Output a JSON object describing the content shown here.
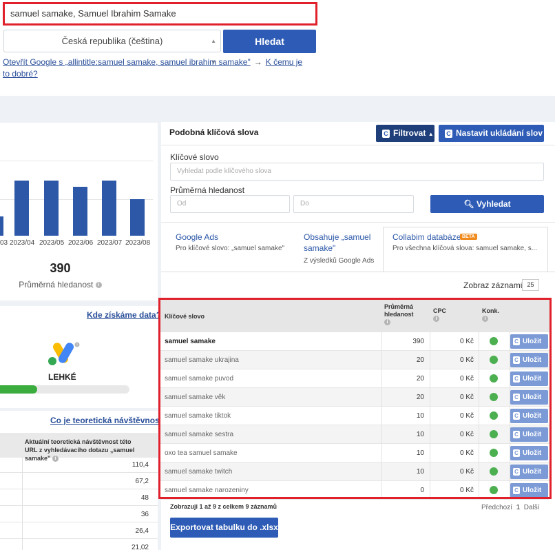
{
  "search": {
    "query": "samuel samake, Samuel Ibrahim Samake",
    "country": "Česká republika (čeština)",
    "submit_label": "Hledat",
    "google_link": "Otevřít Google s „allintitle:samuel samake, samuel ibrahim samake\"",
    "why_link": "K čemu je to dobré?"
  },
  "trend": {
    "x_labels": [
      "03",
      "2023/04",
      "2023/05",
      "2023/06",
      "2023/07",
      "2023/08"
    ],
    "average_value": "390",
    "average_label": "Průměrná hledanost",
    "chart_data": {
      "type": "bar",
      "categories": [
        "03",
        "2023/04",
        "2023/05",
        "2023/06",
        "2023/07",
        "2023/08"
      ],
      "values": [
        200,
        570,
        570,
        510,
        570,
        380
      ],
      "ylim": [
        0,
        800
      ],
      "grid": true
    }
  },
  "difficulty": {
    "link": "Kde získáme data?",
    "value": "LEHKÉ",
    "level": 0.29
  },
  "traffic": {
    "link": "Co je teoretická návštěvnost?",
    "header": "Aktuální teoretická návštěvnost této URL z vyhledávacího dotazu „samuel samake\"",
    "values": [
      "110,4",
      "67,2",
      "48",
      "36",
      "26,4",
      "21,02"
    ]
  },
  "panel": {
    "title": "Podobná klíčová slova",
    "filter_label": "Filtrovat",
    "save_settings_label": "Nastavit ukládání slov",
    "keyword_label": "Klíčové slovo",
    "keyword_placeholder": "Vyhledat podle klíčového slova",
    "volume_label": "Průměrná hledanost",
    "from_placeholder": "Od",
    "to_placeholder": "Do",
    "apply_label": "Vyhledat"
  },
  "tabs": [
    {
      "title": "Google Ads",
      "sub": "Pro klíčové slovo: „samuel samake\""
    },
    {
      "title": "Obsahuje „samuel samake\"",
      "sub": "Z výsledků Google Ads"
    },
    {
      "title": "Collabim databáze",
      "badge": "BETA",
      "sub": "Pro všechna klíčová slova: samuel samake, s..."
    }
  ],
  "table": {
    "records_label": "Zobraz záznamů",
    "records_count": "25",
    "headers": {
      "keyword": "Klíčové slovo",
      "volume": "Průměrná hledanost",
      "cpc": "CPC",
      "competition": "Konk."
    },
    "save_label": "Uložit",
    "rows": [
      {
        "keyword": "samuel samake",
        "volume": "390",
        "cpc": "0 Kč",
        "status": "green"
      },
      {
        "keyword": "samuel samake ukrajina",
        "volume": "20",
        "cpc": "0 Kč",
        "status": "green"
      },
      {
        "keyword": "samuel samake puvod",
        "volume": "20",
        "cpc": "0 Kč",
        "status": "green"
      },
      {
        "keyword": "samuel samake věk",
        "volume": "20",
        "cpc": "0 Kč",
        "status": "green"
      },
      {
        "keyword": "samuel samake tiktok",
        "volume": "10",
        "cpc": "0 Kč",
        "status": "green"
      },
      {
        "keyword": "samuel samake sestra",
        "volume": "10",
        "cpc": "0 Kč",
        "status": "green"
      },
      {
        "keyword": "oxo tea samuel samake",
        "volume": "10",
        "cpc": "0 Kč",
        "status": "green"
      },
      {
        "keyword": "samuel samake twitch",
        "volume": "10",
        "cpc": "0 Kč",
        "status": "green"
      },
      {
        "keyword": "samuel samake narozeniny",
        "volume": "0",
        "cpc": "0 Kč",
        "status": "green"
      }
    ],
    "footer": "Zobrazuji 1 až 9 z celkem 9 záznamů",
    "prev": "Předchozí",
    "page": "1",
    "next": "Další",
    "export_label": "Exportovat tabulku do .xlsx"
  }
}
